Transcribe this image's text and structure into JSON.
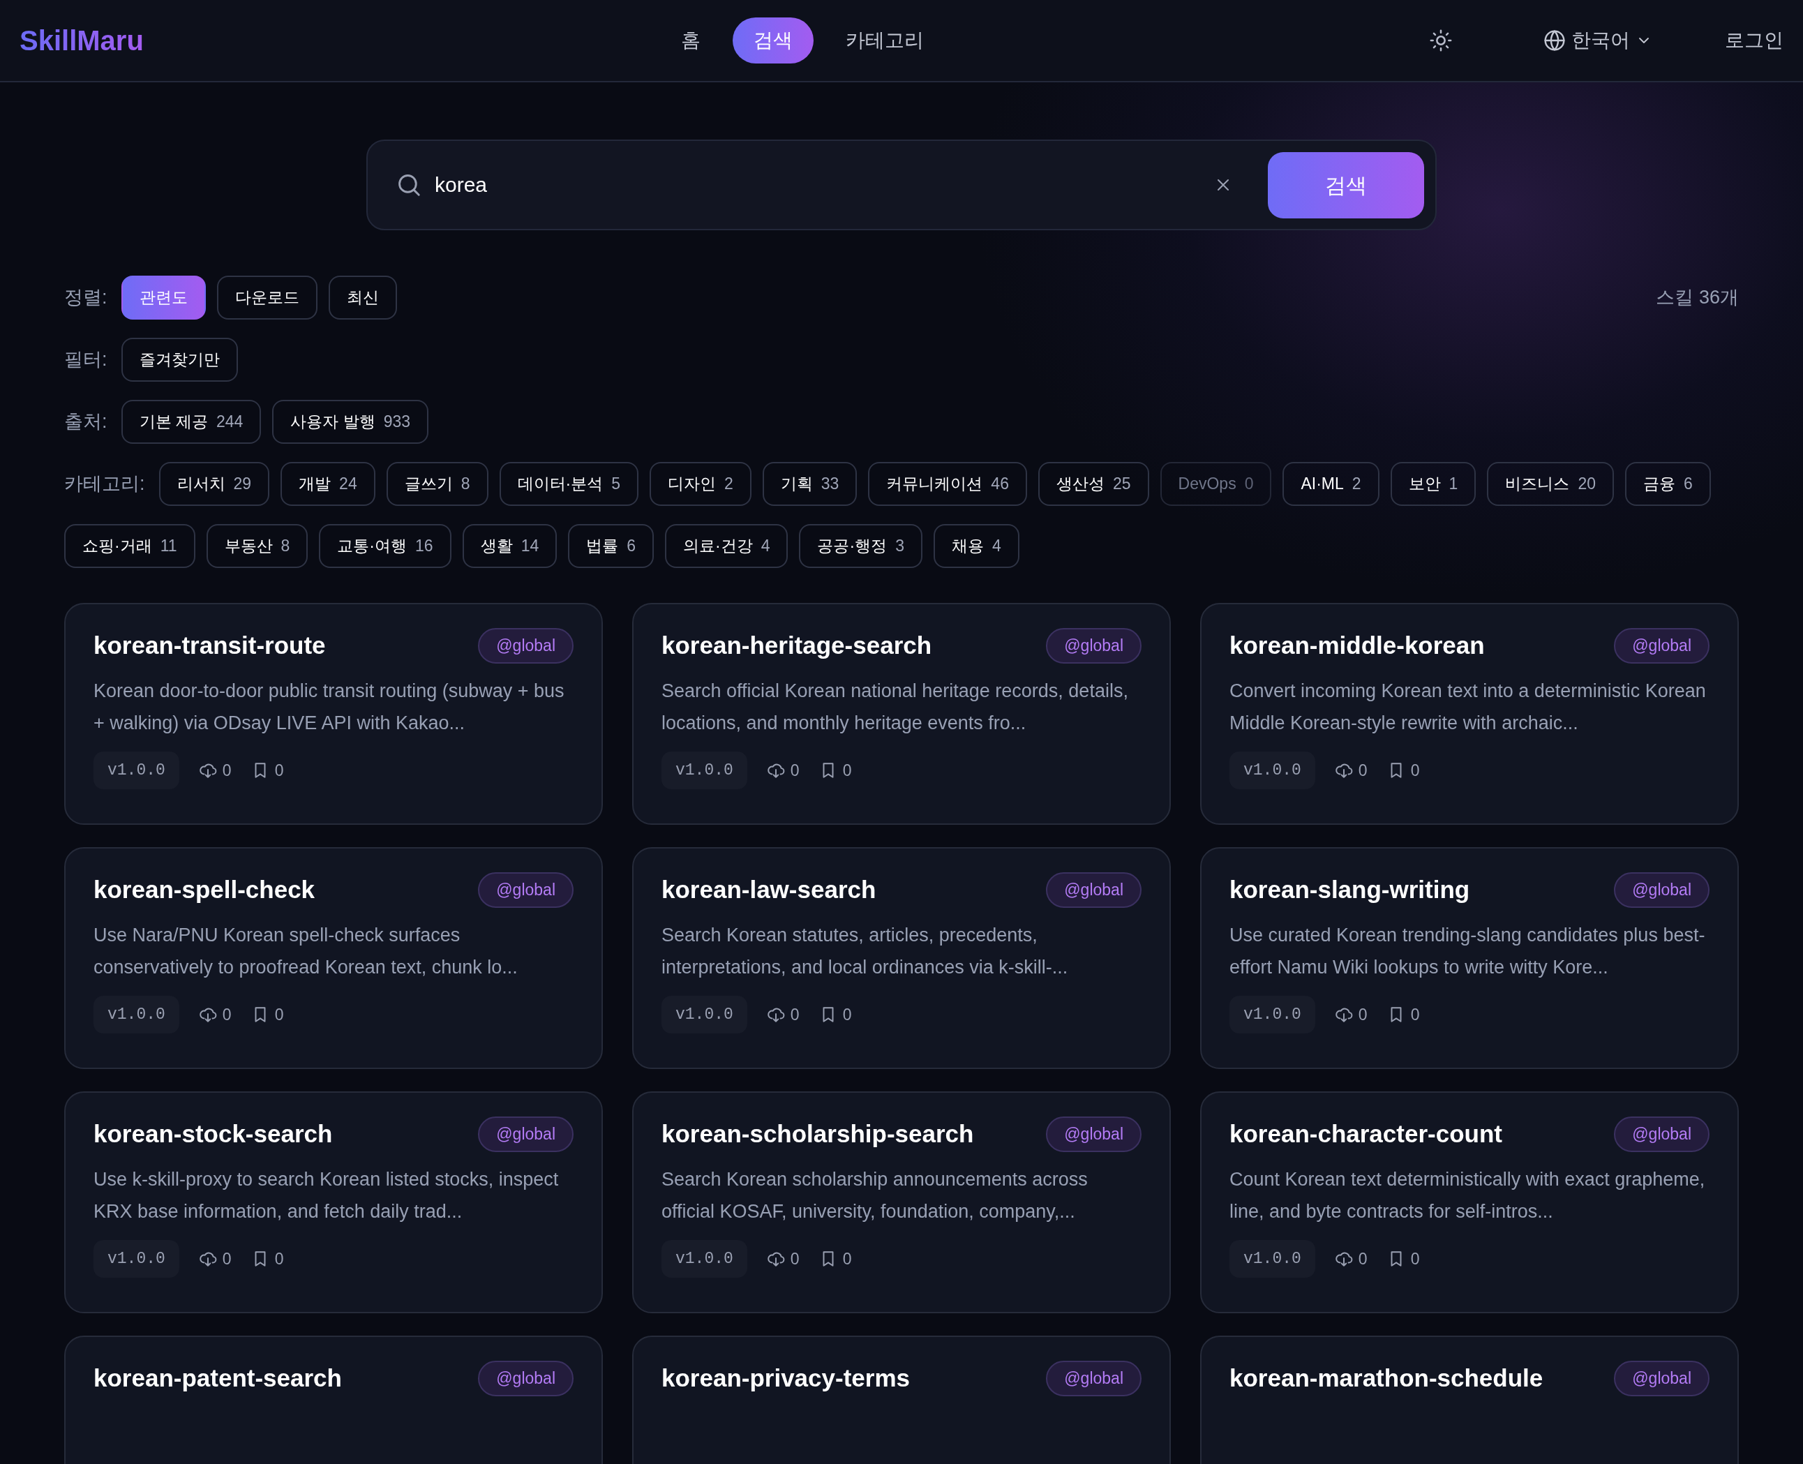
{
  "navbar": {
    "logo": "SkillMaru",
    "links": [
      {
        "label": "홈",
        "selected": false
      },
      {
        "label": "검색",
        "selected": true
      },
      {
        "label": "카테고리",
        "selected": false
      }
    ],
    "language": "한국어",
    "login": "로그인"
  },
  "search": {
    "value": "korea",
    "button": "검색"
  },
  "sort": {
    "label": "정렬:",
    "options": [
      {
        "label": "관련도",
        "selected": true
      },
      {
        "label": "다운로드",
        "selected": false
      },
      {
        "label": "최신",
        "selected": false
      }
    ]
  },
  "result_count": "스킬 36개",
  "filter": {
    "label": "필터:",
    "options": [
      {
        "label": "즐겨찾기만",
        "selected": false
      }
    ]
  },
  "source": {
    "label": "출처:",
    "options": [
      {
        "label": "기본 제공",
        "count": "244"
      },
      {
        "label": "사용자 발행",
        "count": "933"
      }
    ]
  },
  "categories": {
    "label": "카테고리:",
    "options": [
      {
        "label": "리서치",
        "count": "29",
        "disabled": false
      },
      {
        "label": "개발",
        "count": "24",
        "disabled": false
      },
      {
        "label": "글쓰기",
        "count": "8",
        "disabled": false
      },
      {
        "label": "데이터·분석",
        "count": "5",
        "disabled": false
      },
      {
        "label": "디자인",
        "count": "2",
        "disabled": false
      },
      {
        "label": "기획",
        "count": "33",
        "disabled": false
      },
      {
        "label": "커뮤니케이션",
        "count": "46",
        "disabled": false
      },
      {
        "label": "생산성",
        "count": "25",
        "disabled": false
      },
      {
        "label": "DevOps",
        "count": "0",
        "disabled": true
      },
      {
        "label": "AI·ML",
        "count": "2",
        "disabled": false
      },
      {
        "label": "보안",
        "count": "1",
        "disabled": false
      },
      {
        "label": "비즈니스",
        "count": "20",
        "disabled": false
      },
      {
        "label": "금융",
        "count": "6",
        "disabled": false
      },
      {
        "label": "쇼핑·거래",
        "count": "11",
        "disabled": false
      },
      {
        "label": "부동산",
        "count": "8",
        "disabled": false
      },
      {
        "label": "교통·여행",
        "count": "16",
        "disabled": false
      },
      {
        "label": "생활",
        "count": "14",
        "disabled": false
      },
      {
        "label": "법률",
        "count": "6",
        "disabled": false
      },
      {
        "label": "의료·건강",
        "count": "4",
        "disabled": false
      },
      {
        "label": "공공·행정",
        "count": "3",
        "disabled": false
      },
      {
        "label": "채용",
        "count": "4",
        "disabled": false
      }
    ]
  },
  "skills": [
    {
      "name": "korean-transit-route",
      "scope": "@global",
      "description": "Korean door-to-door public transit routing (subway + bus + walking) via ODsay LIVE API with Kakao...",
      "version": "v1.0.0",
      "downloads": "0",
      "bookmarks": "0"
    },
    {
      "name": "korean-heritage-search",
      "scope": "@global",
      "description": "Search official Korean national heritage records, details, locations, and monthly heritage events fro...",
      "version": "v1.0.0",
      "downloads": "0",
      "bookmarks": "0"
    },
    {
      "name": "korean-middle-korean",
      "scope": "@global",
      "description": "Convert incoming Korean text into a deterministic Korean Middle Korean-style rewrite with archaic...",
      "version": "v1.0.0",
      "downloads": "0",
      "bookmarks": "0"
    },
    {
      "name": "korean-spell-check",
      "scope": "@global",
      "description": "Use Nara/PNU Korean spell-check surfaces conservatively to proofread Korean text, chunk lo...",
      "version": "v1.0.0",
      "downloads": "0",
      "bookmarks": "0"
    },
    {
      "name": "korean-law-search",
      "scope": "@global",
      "description": "Search Korean statutes, articles, precedents, interpretations, and local ordinances via k-skill-...",
      "version": "v1.0.0",
      "downloads": "0",
      "bookmarks": "0"
    },
    {
      "name": "korean-slang-writing",
      "scope": "@global",
      "description": "Use curated Korean trending-slang candidates plus best-effort Namu Wiki lookups to write witty Kore...",
      "version": "v1.0.0",
      "downloads": "0",
      "bookmarks": "0"
    },
    {
      "name": "korean-stock-search",
      "scope": "@global",
      "description": "Use k-skill-proxy to search Korean listed stocks, inspect KRX base information, and fetch daily trad...",
      "version": "v1.0.0",
      "downloads": "0",
      "bookmarks": "0"
    },
    {
      "name": "korean-scholarship-search",
      "scope": "@global",
      "description": "Search Korean scholarship announcements across official KOSAF, university, foundation, company,...",
      "version": "v1.0.0",
      "downloads": "0",
      "bookmarks": "0"
    },
    {
      "name": "korean-character-count",
      "scope": "@global",
      "description": "Count Korean text deterministically with exact grapheme, line, and byte contracts for self-intros...",
      "version": "v1.0.0",
      "downloads": "0",
      "bookmarks": "0"
    },
    {
      "name": "korean-patent-search",
      "scope": "@global"
    },
    {
      "name": "korean-privacy-terms",
      "scope": "@global"
    },
    {
      "name": "korean-marathon-schedule",
      "scope": "@global"
    }
  ]
}
